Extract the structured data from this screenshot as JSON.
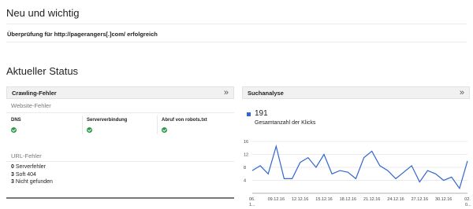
{
  "news": {
    "title": "Neu und wichtig",
    "message": "Überprüfung für http://pagerangers[.]com/ erfolgreich"
  },
  "status": {
    "title": "Aktueller Status"
  },
  "crawl": {
    "title": "Crawling-Fehler",
    "expand_icon": "double-chevron-right-icon",
    "site_errors_label": "Website-Fehler",
    "site_checks": [
      {
        "label": "DNS",
        "status": "ok",
        "icon": "check-circle-icon"
      },
      {
        "label": "Serververbindung",
        "status": "ok",
        "icon": "check-circle-icon"
      },
      {
        "label": "Abruf von robots.txt",
        "status": "ok",
        "icon": "check-circle-icon"
      }
    ],
    "url_errors_label": "URL-Fehler",
    "url_errors": [
      {
        "count": "0",
        "label": "Serverfehler"
      },
      {
        "count": "3",
        "label": "Soft 404"
      },
      {
        "count": "3",
        "label": "Nicht gefunden"
      }
    ]
  },
  "search": {
    "title": "Suchanalyse",
    "expand_icon": "double-chevron-right-icon",
    "total_clicks": "191",
    "total_clicks_label": "Gesamtanzahl der Klicks",
    "series_color": "#3366cc"
  },
  "chart_data": {
    "type": "line",
    "ylim": [
      0,
      16
    ],
    "yticks": [
      "4",
      "8",
      "12",
      "16"
    ],
    "xticks": [
      "06.",
      "09.12.16",
      "12.12.16",
      "15.12.16",
      "18.12.16",
      "21.12.16",
      "24.12.16",
      "27.12.16",
      "30.12.16",
      "02."
    ],
    "xticks_sub": [
      "1...",
      "",
      "",
      "",
      "",
      "",
      "",
      "",
      "",
      "0..."
    ],
    "x": [
      "06.12.16",
      "07.12.16",
      "08.12.16",
      "09.12.16",
      "10.12.16",
      "11.12.16",
      "12.12.16",
      "13.12.16",
      "14.12.16",
      "15.12.16",
      "16.12.16",
      "17.12.16",
      "18.12.16",
      "19.12.16",
      "20.12.16",
      "21.12.16",
      "22.12.16",
      "23.12.16",
      "24.12.16",
      "25.12.16",
      "26.12.16",
      "27.12.16",
      "28.12.16",
      "29.12.16",
      "30.12.16",
      "31.12.16",
      "01.01.17",
      "02.01.17"
    ],
    "series": [
      {
        "color": "#3366cc",
        "values": [
          7,
          8.5,
          6,
          14.5,
          4.5,
          4.5,
          9.5,
          11,
          8,
          12,
          6,
          7,
          6.5,
          4.5,
          11,
          13,
          8.5,
          7,
          4.5,
          6.5,
          8.5,
          3.5,
          7,
          6,
          4,
          5,
          1.5,
          10
        ]
      }
    ]
  }
}
